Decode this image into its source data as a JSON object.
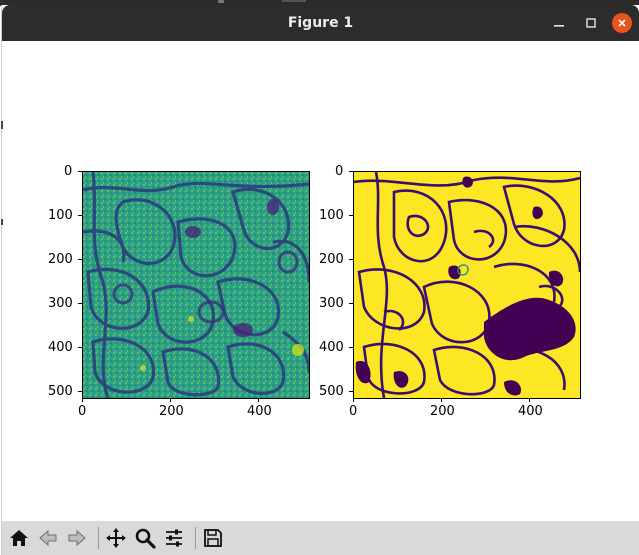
{
  "window": {
    "title": "Figure 1",
    "controls": [
      "minimize",
      "maximize",
      "close"
    ],
    "accent_close": "#e95420"
  },
  "figure": {
    "left_axes": {
      "x_ticks": [
        "0",
        "200",
        "400"
      ],
      "y_ticks": [
        "0",
        "100",
        "200",
        "300",
        "400",
        "500"
      ],
      "colormap": "viridis",
      "content": "grayscale microscopy image rendered with viridis colormap"
    },
    "right_axes": {
      "x_ticks": [
        "0",
        "200",
        "400"
      ],
      "y_ticks": [
        "0",
        "100",
        "200",
        "300",
        "400",
        "500"
      ],
      "colormap": "viridis",
      "content": "binary segmentation mask (yellow cells, purple membranes)"
    },
    "colors": {
      "low": "#440154",
      "mid": "#21918c",
      "high": "#fde725",
      "membrane": "#3b0f70"
    }
  },
  "toolbar": {
    "items": [
      "home-icon",
      "back-icon",
      "forward-icon",
      "pan-icon",
      "zoom-icon",
      "configure-subplots-icon",
      "save-icon"
    ]
  }
}
